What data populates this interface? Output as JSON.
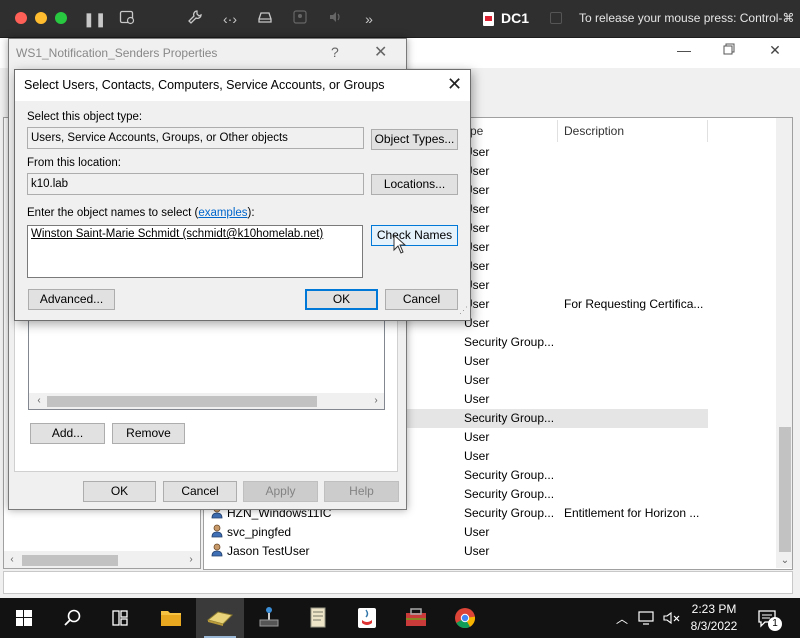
{
  "vm_toolbar": {
    "title": "DC1",
    "release_hint": "To release your mouse press: Control-⌘",
    "colors": {
      "close": "#fe5f57",
      "minimize": "#febc2e",
      "maximize": "#28c840"
    }
  },
  "background_list": {
    "columns": [
      "ype",
      "Description"
    ],
    "rows": [
      {
        "name": "",
        "type": "User",
        "desc": ""
      },
      {
        "name": "",
        "type": "User",
        "desc": ""
      },
      {
        "name": "",
        "type": "User",
        "desc": ""
      },
      {
        "name": "",
        "type": "User",
        "desc": ""
      },
      {
        "name": "",
        "type": "User",
        "desc": ""
      },
      {
        "name": "",
        "type": "User",
        "desc": ""
      },
      {
        "name": "",
        "type": "User",
        "desc": ""
      },
      {
        "name": "",
        "type": "User",
        "desc": ""
      },
      {
        "name": "",
        "type": "User",
        "desc": "For Requesting Certifica..."
      },
      {
        "name": "",
        "type": "User",
        "desc": ""
      },
      {
        "name": "",
        "type": "Security Group...",
        "desc": ""
      },
      {
        "name": "",
        "type": "User",
        "desc": ""
      },
      {
        "name": "",
        "type": "User",
        "desc": ""
      },
      {
        "name": "",
        "type": "User",
        "desc": ""
      },
      {
        "name": "",
        "type": "Security Group...",
        "desc": ""
      },
      {
        "name": "",
        "type": "User",
        "desc": ""
      },
      {
        "name": "",
        "type": "User",
        "desc": ""
      },
      {
        "name": "",
        "type": "Security Group...",
        "desc": ""
      },
      {
        "name": "",
        "type": "Security Group...",
        "desc": ""
      },
      {
        "name": "HZN_Windows11IC",
        "type": "Security Group...",
        "desc": "Entitlement for Horizon ..."
      },
      {
        "name": "svc_pingfed",
        "type": "User",
        "desc": ""
      },
      {
        "name": "Jason TestUser",
        "type": "User",
        "desc": ""
      }
    ]
  },
  "props_dialog": {
    "title": "WS1_Notification_Senders Properties",
    "help": "?",
    "add_label": "Add...",
    "remove_label": "Remove",
    "ok_label": "OK",
    "cancel_label": "Cancel",
    "apply_label": "Apply",
    "help_label": "Help"
  },
  "select_dialog": {
    "title": "Select Users, Contacts, Computers, Service Accounts, or Groups",
    "object_type_label": "Select this object type:",
    "object_type_value": "Users, Service Accounts, Groups, or Other objects",
    "object_types_button": "Object Types...",
    "location_label": "From this location:",
    "location_value": "k10.lab",
    "locations_button": "Locations...",
    "names_label_prefix": "Enter the object names to select (",
    "names_label_link": "examples",
    "names_label_suffix": "):",
    "names_value": "Winston Saint-Marie Schmidt (schmidt@k10homelab.net)",
    "check_names_button": "Check Names",
    "advanced_button": "Advanced...",
    "ok_button": "OK",
    "cancel_button": "Cancel"
  },
  "taskbar": {
    "time": "2:23 PM",
    "date": "8/3/2022",
    "notification_count": "1"
  }
}
